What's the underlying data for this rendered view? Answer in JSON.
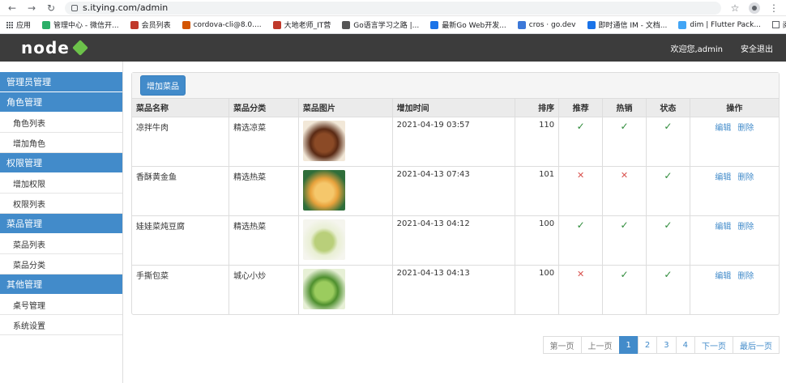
{
  "browser": {
    "url": "s.itying.com/admin",
    "bookmarks": [
      {
        "label": "应用",
        "color": "#5f6368"
      },
      {
        "label": "管理中心 - 微信开...",
        "color": "#2aae67"
      },
      {
        "label": "会员列表",
        "color": "#c0392b"
      },
      {
        "label": "cordova-cli@8.0....",
        "color": "#d35400"
      },
      {
        "label": "大地老师_IT营",
        "color": "#c0392b"
      },
      {
        "label": "Go语言学习之路 |...",
        "color": "#555555"
      },
      {
        "label": "最新Go Web开发...",
        "color": "#1a73e8"
      },
      {
        "label": "cros · go.dev",
        "color": "#3c78d8"
      },
      {
        "label": "即时通信 IM - 文档...",
        "color": "#1a73e8"
      },
      {
        "label": "dim | Flutter Pack...",
        "color": "#42a5f5"
      }
    ],
    "reader_label": "阅读清单"
  },
  "header": {
    "logo_text": "node",
    "welcome": "欢迎您,admin",
    "logout": "安全退出"
  },
  "sidebar": {
    "groups": [
      {
        "title": "管理员管理",
        "items": []
      },
      {
        "title": "角色管理",
        "items": [
          "角色列表",
          "增加角色"
        ]
      },
      {
        "title": "权限管理",
        "items": [
          "增加权限",
          "权限列表"
        ]
      },
      {
        "title": "菜品管理",
        "items": [
          "菜品列表",
          "菜品分类"
        ]
      },
      {
        "title": "其他管理",
        "items": [
          "桌号管理",
          "系统设置"
        ]
      }
    ]
  },
  "toolbar": {
    "add_label": "增加菜品"
  },
  "table": {
    "headers": [
      "菜品名称",
      "菜品分类",
      "菜品图片",
      "增加时间",
      "排序",
      "推荐",
      "热销",
      "状态",
      "操作"
    ],
    "edit_label": "编辑",
    "delete_label": "删除",
    "rows": [
      {
        "name": "凉拌牛肉",
        "category": "精选凉菜",
        "time": "2021-04-19 03:57",
        "sort": "110",
        "recommend": true,
        "hot": true,
        "status": true,
        "img_colors": [
          "#5a2a14",
          "#8b4a26",
          "#f2e8d8"
        ]
      },
      {
        "name": "香酥黄金鱼",
        "category": "精选热菜",
        "time": "2021-04-13 07:43",
        "sort": "101",
        "recommend": false,
        "hot": false,
        "status": true,
        "img_colors": [
          "#e8a23c",
          "#f5c76b",
          "#2f6e3a"
        ]
      },
      {
        "name": "娃娃菜炖豆腐",
        "category": "精选热菜",
        "time": "2021-04-13 04:12",
        "sort": "100",
        "recommend": true,
        "hot": true,
        "status": true,
        "img_colors": [
          "#e9efd4",
          "#b9cf7a",
          "#f5f5ee"
        ]
      },
      {
        "name": "手撕包菜",
        "category": "城心小炒",
        "time": "2021-04-13 04:13",
        "sort": "100",
        "recommend": false,
        "hot": true,
        "status": true,
        "img_colors": [
          "#4e8f2e",
          "#9bcc5e",
          "#e7f0d6"
        ]
      }
    ]
  },
  "pagination": {
    "first": "第一页",
    "prev": "上一页",
    "pages": [
      "1",
      "2",
      "3",
      "4"
    ],
    "active": "1",
    "next": "下一页",
    "last": "最后一页"
  }
}
